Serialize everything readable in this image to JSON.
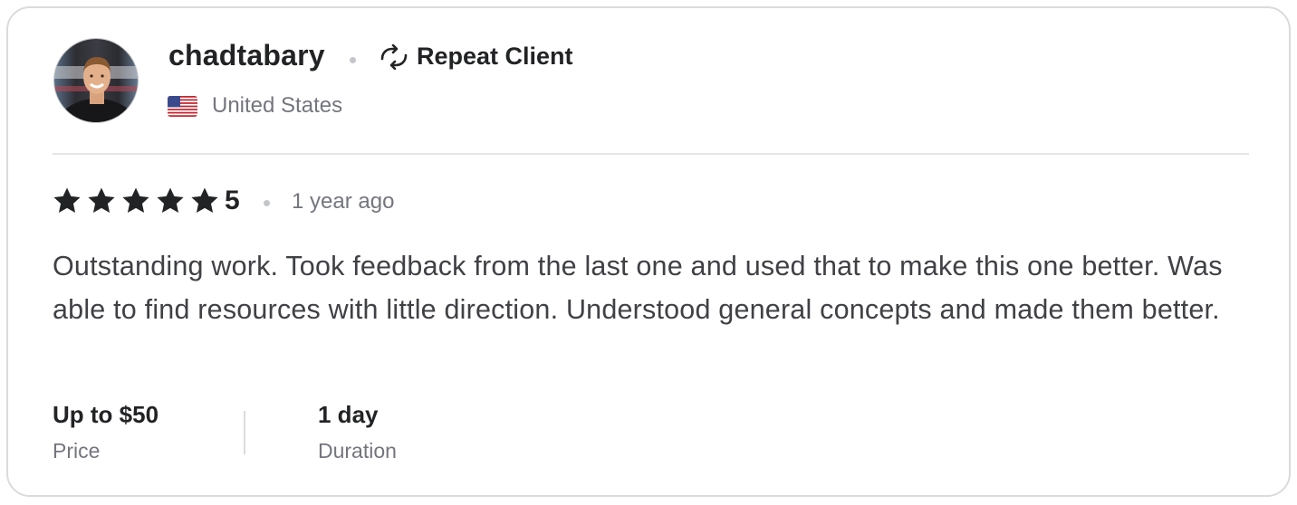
{
  "reviewer": {
    "username": "chadtabary",
    "badge_label": "Repeat Client",
    "badge_icon": "repeat-icon",
    "country": "United States",
    "flag_icon": "us-flag-icon"
  },
  "rating": {
    "stars": 5,
    "max_stars": 5,
    "value_label": "5",
    "time_ago": "1 year ago"
  },
  "review": {
    "text": "Outstanding work. Took feedback from the last one and used that to make this one better. Was able to find resources with little direction. Understood general concepts and made them better."
  },
  "meta": {
    "price": {
      "value": "Up to $50",
      "label": "Price"
    },
    "duration": {
      "value": "1 day",
      "label": "Duration"
    }
  },
  "colors": {
    "text_primary": "#222325",
    "text_secondary": "#74767e",
    "text_body": "#404145",
    "border": "#dadbdd",
    "star": "#222325"
  }
}
